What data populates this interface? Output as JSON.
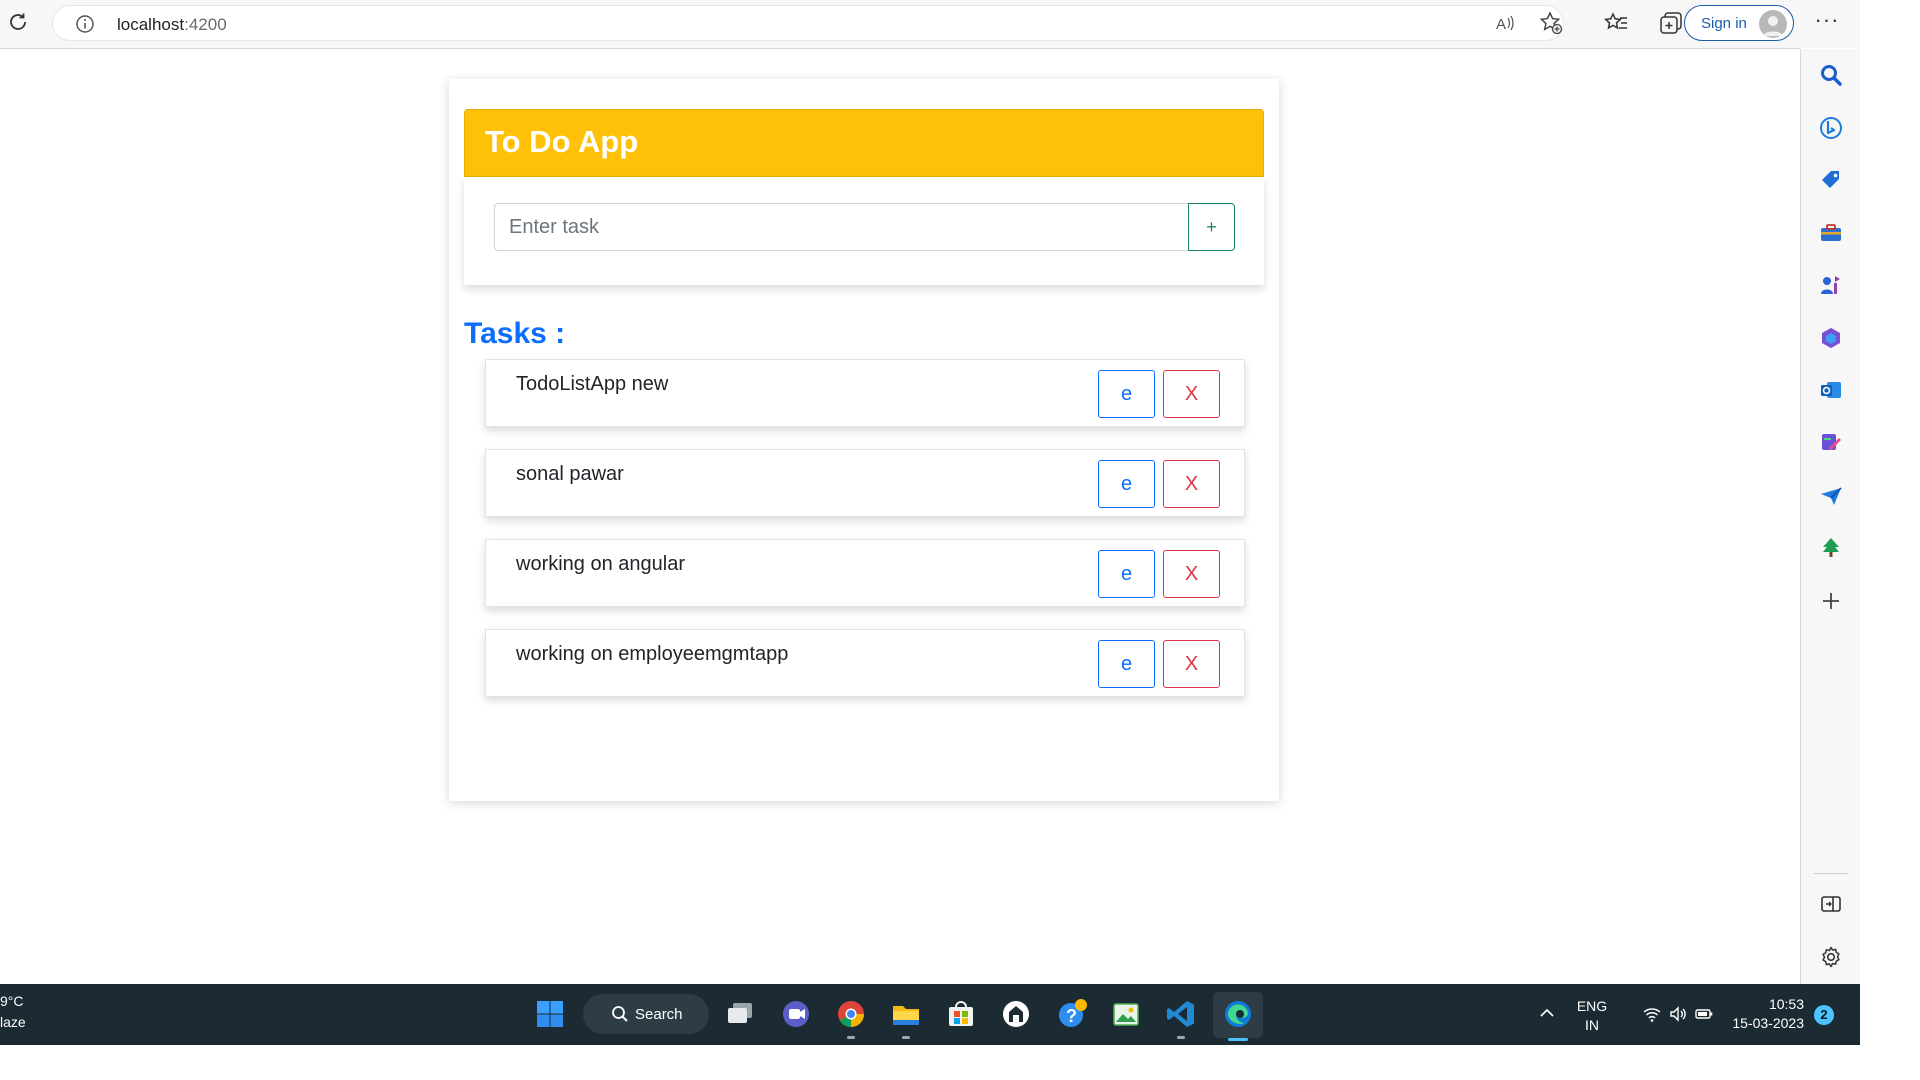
{
  "browser": {
    "url_host": "localhost",
    "url_port": ":4200",
    "sign_in_label": "Sign in",
    "more_label": "···",
    "icons": [
      "reload-icon",
      "info-icon",
      "read-aloud-icon",
      "add-favorite-icon",
      "favorites-icon",
      "collections-icon",
      "avatar-icon",
      "more-icon"
    ]
  },
  "sidebar": {
    "icons": [
      "search-icon",
      "bing-icon",
      "shopping-icon",
      "tools-icon",
      "games-icon",
      "office-icon",
      "outlook-icon",
      "designer-icon",
      "send-icon",
      "tree-icon",
      "add-icon",
      "split-screen-icon",
      "settings-icon"
    ]
  },
  "app": {
    "title": "To Do App",
    "input_placeholder": "Enter task",
    "add_label": "+",
    "tasks_heading": "Tasks :",
    "tasks": [
      {
        "text": "TodoListApp new",
        "edit_label": "e",
        "delete_label": "X"
      },
      {
        "text": "sonal pawar",
        "edit_label": "e",
        "delete_label": "X"
      },
      {
        "text": "working on angular",
        "edit_label": "e",
        "delete_label": "X"
      },
      {
        "text": "working on employeemgmtapp",
        "edit_label": "e",
        "delete_label": "X"
      }
    ],
    "colors": {
      "header": "#ffc107",
      "heading": "#0d6efd",
      "edit": "#0d6efd",
      "delete": "#dc3545",
      "add": "#198754"
    }
  },
  "taskbar": {
    "weather_temp": "9°C",
    "weather_desc": "laze",
    "search_label": "Search",
    "lang_line1": "ENG",
    "lang_line2": "IN",
    "time": "10:53",
    "date": "15-03-2023",
    "notification_count": "2",
    "apps": [
      "windows-start-icon",
      "task-view-icon",
      "teams-icon",
      "chrome-icon",
      "file-explorer-icon",
      "store-icon",
      "app-icon",
      "help-icon",
      "photos-icon",
      "vscode-icon",
      "edge-icon"
    ]
  }
}
